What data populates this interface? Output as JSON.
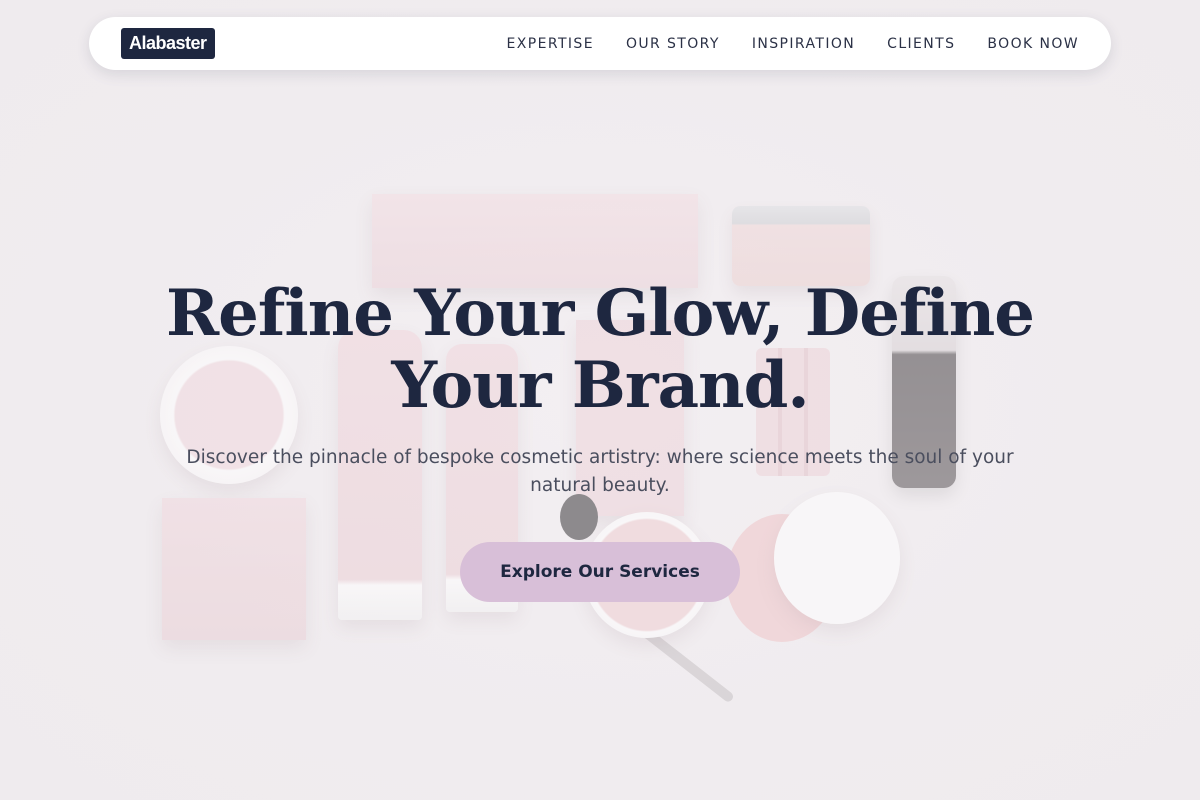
{
  "nav": {
    "logo": "Alabaster",
    "links": [
      "EXPERTISE",
      "OUR STORY",
      "INSPIRATION",
      "CLIENTS",
      "BOOK NOW"
    ]
  },
  "hero": {
    "title": "Refine Your Glow, Define Your Brand.",
    "subtitle": "Discover the pinnacle of bespoke cosmetic artistry: where science meets the soul of your natural beauty.",
    "cta_label": "Explore Our Services"
  },
  "colors": {
    "brand_dark": "#1e2740",
    "accent": "#d8bfd8",
    "background": "#f1edf0"
  }
}
